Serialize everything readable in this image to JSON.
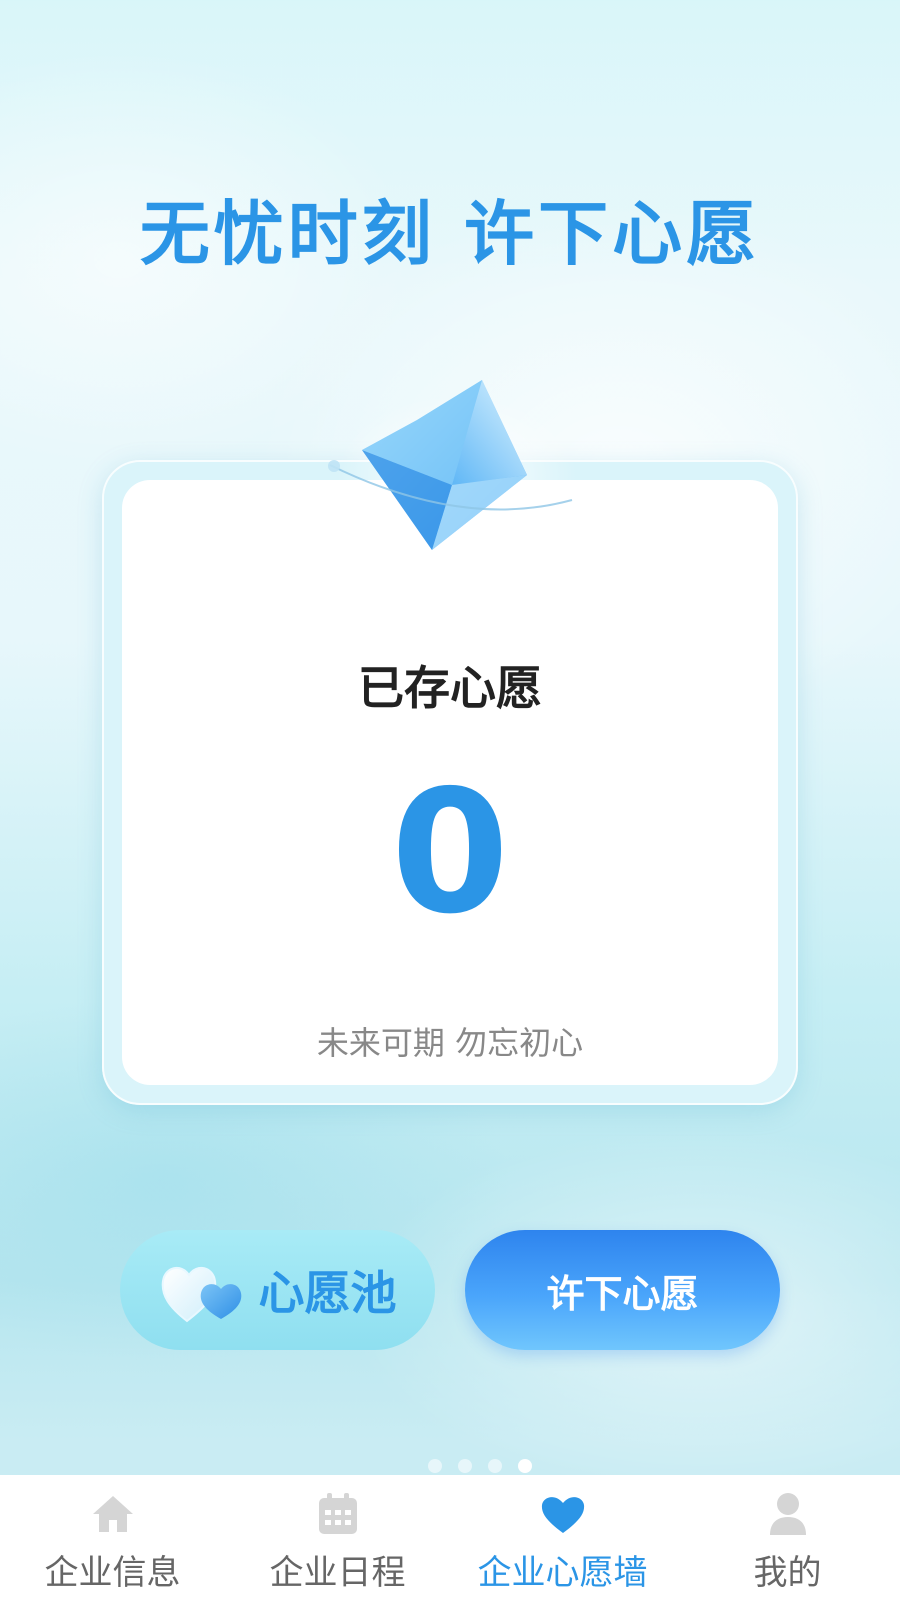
{
  "headline": "无忧时刻 许下心愿",
  "card": {
    "title": "已存心愿",
    "count": "0",
    "subtitle": "未来可期 勿忘初心"
  },
  "buttons": {
    "pool_label": "心愿池",
    "make_wish_label": "许下心愿"
  },
  "pager": {
    "total": 4,
    "active_index": 3
  },
  "tabbar": {
    "items": [
      {
        "label": "企业信息",
        "icon": "home-icon",
        "active": false
      },
      {
        "label": "企业日程",
        "icon": "calendar-icon",
        "active": false
      },
      {
        "label": "企业心愿墙",
        "icon": "heart-icon",
        "active": true
      },
      {
        "label": "我的",
        "icon": "user-icon",
        "active": false
      }
    ]
  },
  "colors": {
    "accent": "#2b95e6",
    "inactive_text": "#666666",
    "inactive_icon": "#d5d5d5"
  }
}
